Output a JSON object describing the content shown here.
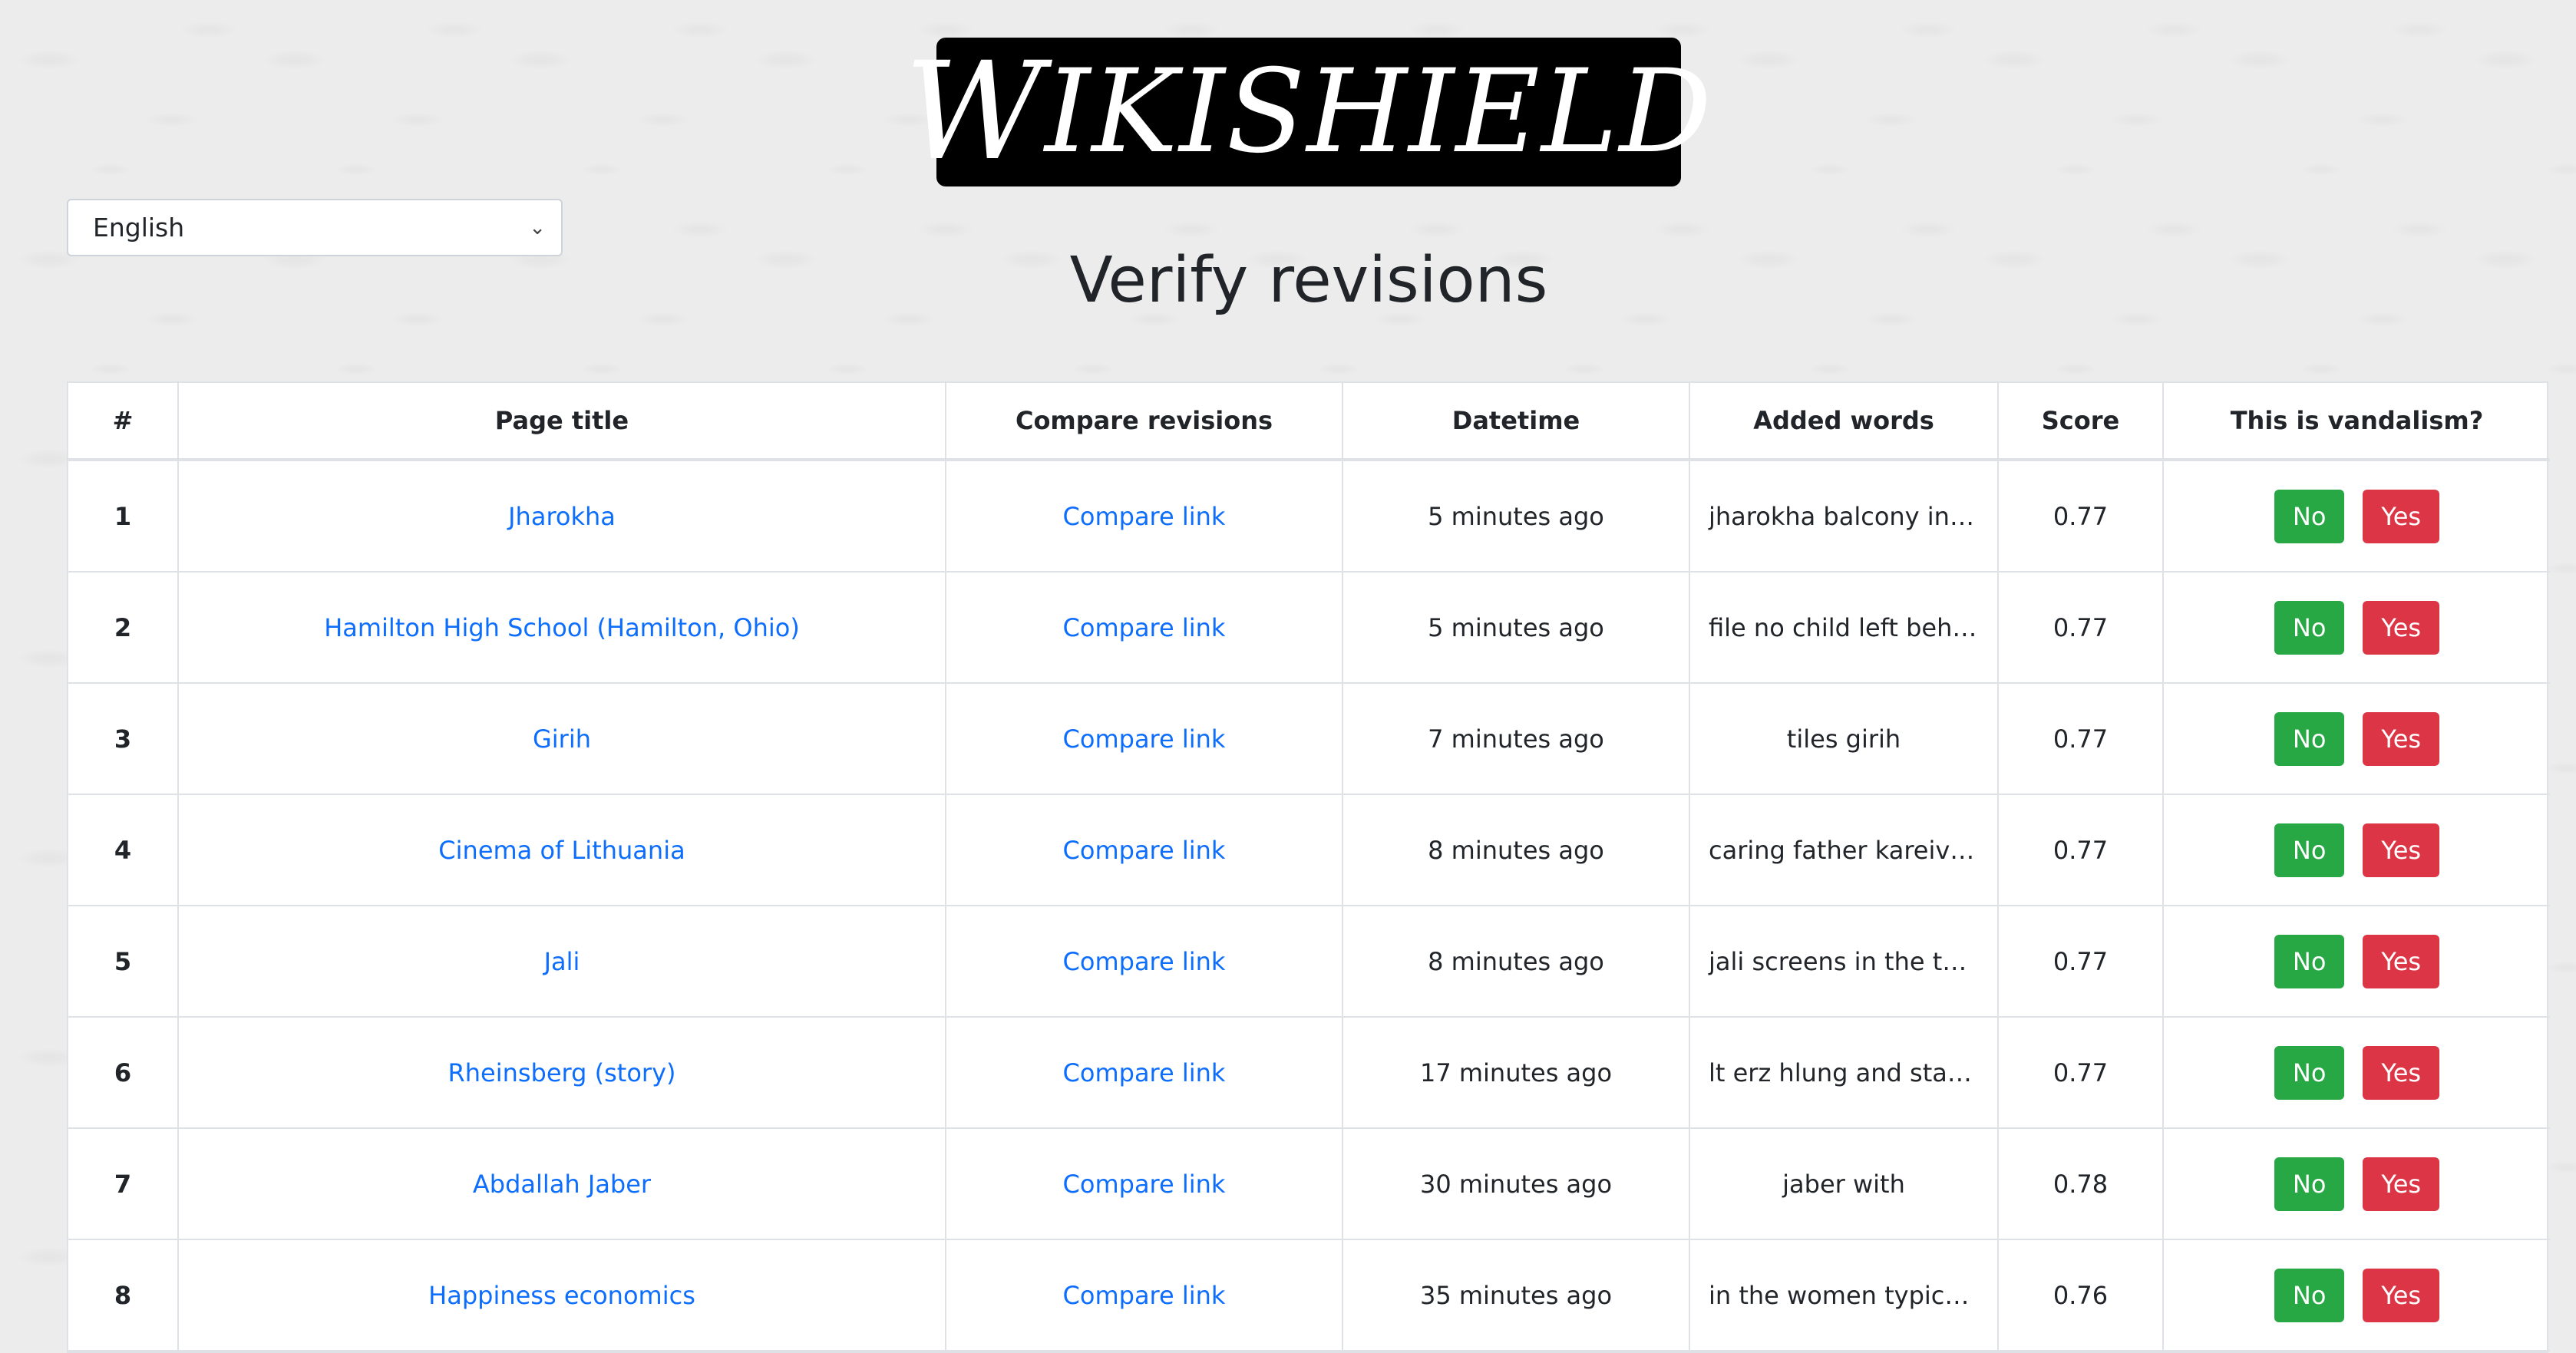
{
  "logo": {
    "first": "W",
    "rest": "IKISHIELD"
  },
  "language": {
    "selected": "English"
  },
  "title": "Verify revisions",
  "table": {
    "headers": [
      "#",
      "Page title",
      "Compare revisions",
      "Datetime",
      "Added words",
      "Score",
      "This is vandalism?"
    ],
    "rows": [
      {
        "num": "1",
        "page": "Jharokha",
        "compare": "Compare link",
        "datetime": "5 minutes ago",
        "added": "jharokha balcony in j…",
        "score": "0.77",
        "no": "No",
        "yes": "Yes"
      },
      {
        "num": "2",
        "page": "Hamilton High School (Hamilton, Ohio)",
        "compare": "Compare link",
        "datetime": "5 minutes ago",
        "added": "file no child left behi…",
        "score": "0.77",
        "no": "No",
        "yes": "Yes"
      },
      {
        "num": "3",
        "page": "Girih",
        "compare": "Compare link",
        "datetime": "7 minutes ago",
        "added": "tiles girih",
        "score": "0.77",
        "no": "No",
        "yes": "Yes"
      },
      {
        "num": "4",
        "page": "Cinema of Lithuania",
        "compare": "Compare link",
        "datetime": "8 minutes ago",
        "added": "caring father kareivis…",
        "score": "0.77",
        "no": "No",
        "yes": "Yes"
      },
      {
        "num": "5",
        "page": "Jali",
        "compare": "Compare link",
        "datetime": "8 minutes ago",
        "added": "jali screens in the tomb",
        "score": "0.77",
        "no": "No",
        "yes": "Yes"
      },
      {
        "num": "6",
        "page": "Rheinsberg (story)",
        "compare": "Compare link",
        "datetime": "17 minutes ago",
        "added": "lt erz hlung and stag…",
        "score": "0.77",
        "no": "No",
        "yes": "Yes"
      },
      {
        "num": "7",
        "page": "Abdallah Jaber",
        "compare": "Compare link",
        "datetime": "30 minutes ago",
        "added": "jaber with",
        "score": "0.78",
        "no": "No",
        "yes": "Yes"
      },
      {
        "num": "8",
        "page": "Happiness economics",
        "compare": "Compare link",
        "datetime": "35 minutes ago",
        "added": "in the women typical…",
        "score": "0.76",
        "no": "No",
        "yes": "Yes"
      }
    ]
  },
  "colors": {
    "link": "#0d6efd",
    "no_button": "#28a745",
    "yes_button": "#dc3545",
    "logo_bg": "#000000"
  }
}
